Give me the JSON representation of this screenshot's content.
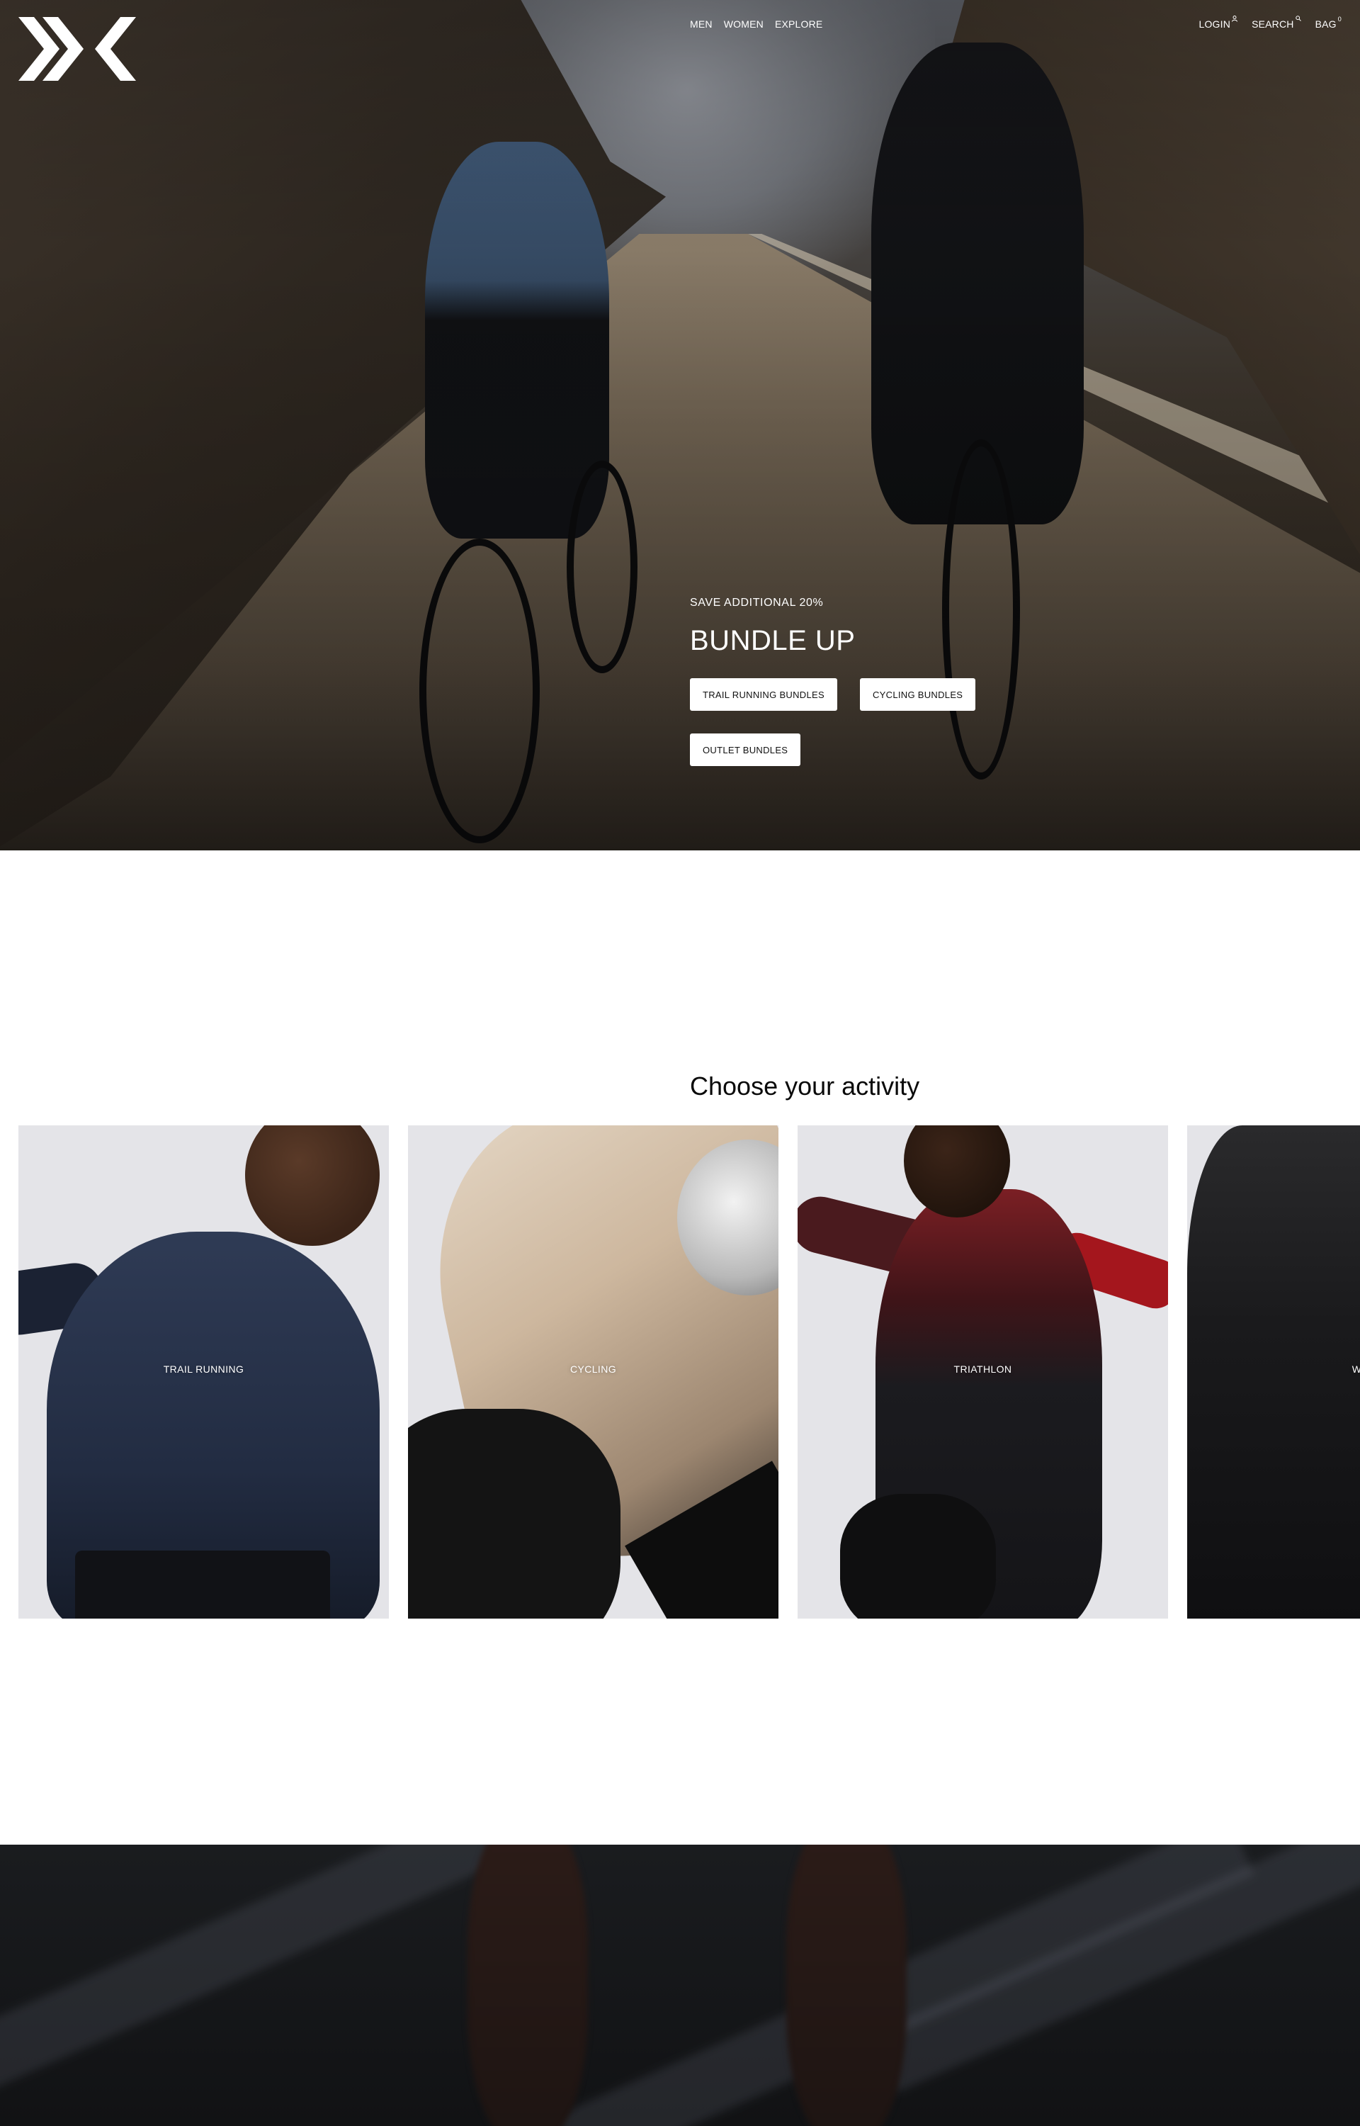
{
  "header": {
    "logo_alt": "X-BIONIC logo",
    "nav_main": [
      {
        "label": "MEN"
      },
      {
        "label": "WOMEN"
      },
      {
        "label": "EXPLORE"
      }
    ],
    "nav_util": {
      "login_label": "LOGIN",
      "search_label": "SEARCH",
      "bag_label": "BAG",
      "bag_count": "0"
    }
  },
  "hero": {
    "eyebrow": "SAVE ADDITIONAL 20%",
    "title": "BUNDLE UP",
    "buttons": [
      {
        "label": "TRAIL RUNNING BUNDLES"
      },
      {
        "label": "CYCLING BUNDLES"
      },
      {
        "label": "OUTLET BUNDLES"
      }
    ]
  },
  "activity": {
    "title": "Choose your activity",
    "cards": [
      {
        "label": "TRAIL RUNNING"
      },
      {
        "label": "CYCLING"
      },
      {
        "label": "TRIATHLON"
      },
      {
        "label": "WINTER"
      }
    ]
  },
  "colors": {
    "card_background": "#e4e4e8",
    "button_background": "#ffffff",
    "text_on_dark": "#ffffff"
  }
}
